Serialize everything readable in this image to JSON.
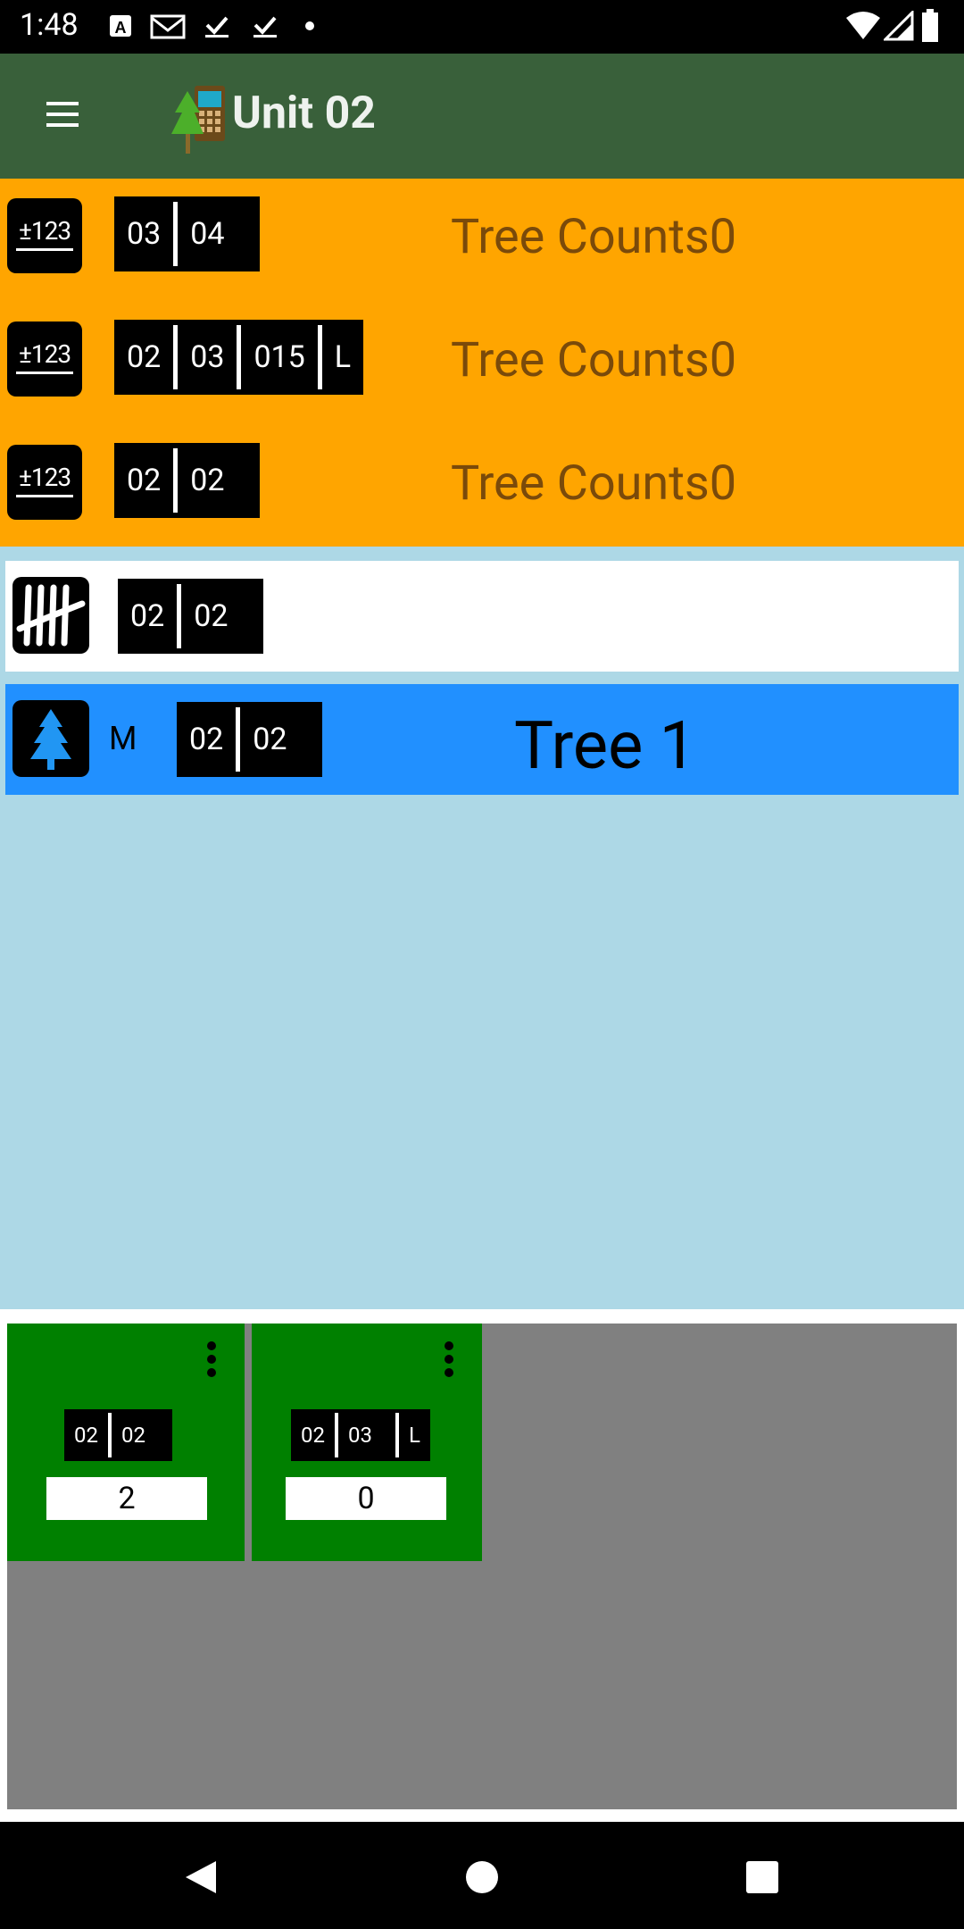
{
  "status_bar": {
    "time": "1:48",
    "left_icons": [
      "a-box-icon",
      "gmail-icon",
      "check-icon",
      "check-icon",
      "dot-icon"
    ],
    "right_icons": [
      "wifi-icon",
      "signal-icon",
      "battery-icon"
    ]
  },
  "app_bar": {
    "title": "Unit 02",
    "menu_icon": "hamburger-menu-icon",
    "logo_icon": "tree-tablet-logo-icon"
  },
  "count_rows": [
    {
      "icon": "plus-minus-123-icon",
      "icon_text": "±123",
      "codes": [
        "03",
        "04"
      ],
      "label": "Tree Counts0"
    },
    {
      "icon": "plus-minus-123-icon",
      "icon_text": "±123",
      "codes": [
        "02",
        "03",
        "015",
        "L"
      ],
      "label": "Tree Counts0"
    },
    {
      "icon": "plus-minus-123-icon",
      "icon_text": "±123",
      "codes": [
        "02",
        "02"
      ],
      "label": "Tree Counts0"
    }
  ],
  "tally_row": {
    "icon": "tally-marks-icon",
    "codes": [
      "02",
      "02"
    ]
  },
  "tree_row": {
    "icon": "tree-icon",
    "marker": "M",
    "codes": [
      "02",
      "02"
    ],
    "title": "Tree 1"
  },
  "cards": [
    {
      "codes": [
        "02",
        "02"
      ],
      "count": "2"
    },
    {
      "codes": [
        "02",
        "03",
        "L"
      ],
      "count": "0"
    }
  ],
  "colors": {
    "app_bar": "#39603a",
    "count_section": "#ffa500",
    "count_label": "#7a4a0a",
    "background": "#add8e6",
    "tree_row": "#2190ff",
    "card": "#008000",
    "grid": "#808080"
  }
}
